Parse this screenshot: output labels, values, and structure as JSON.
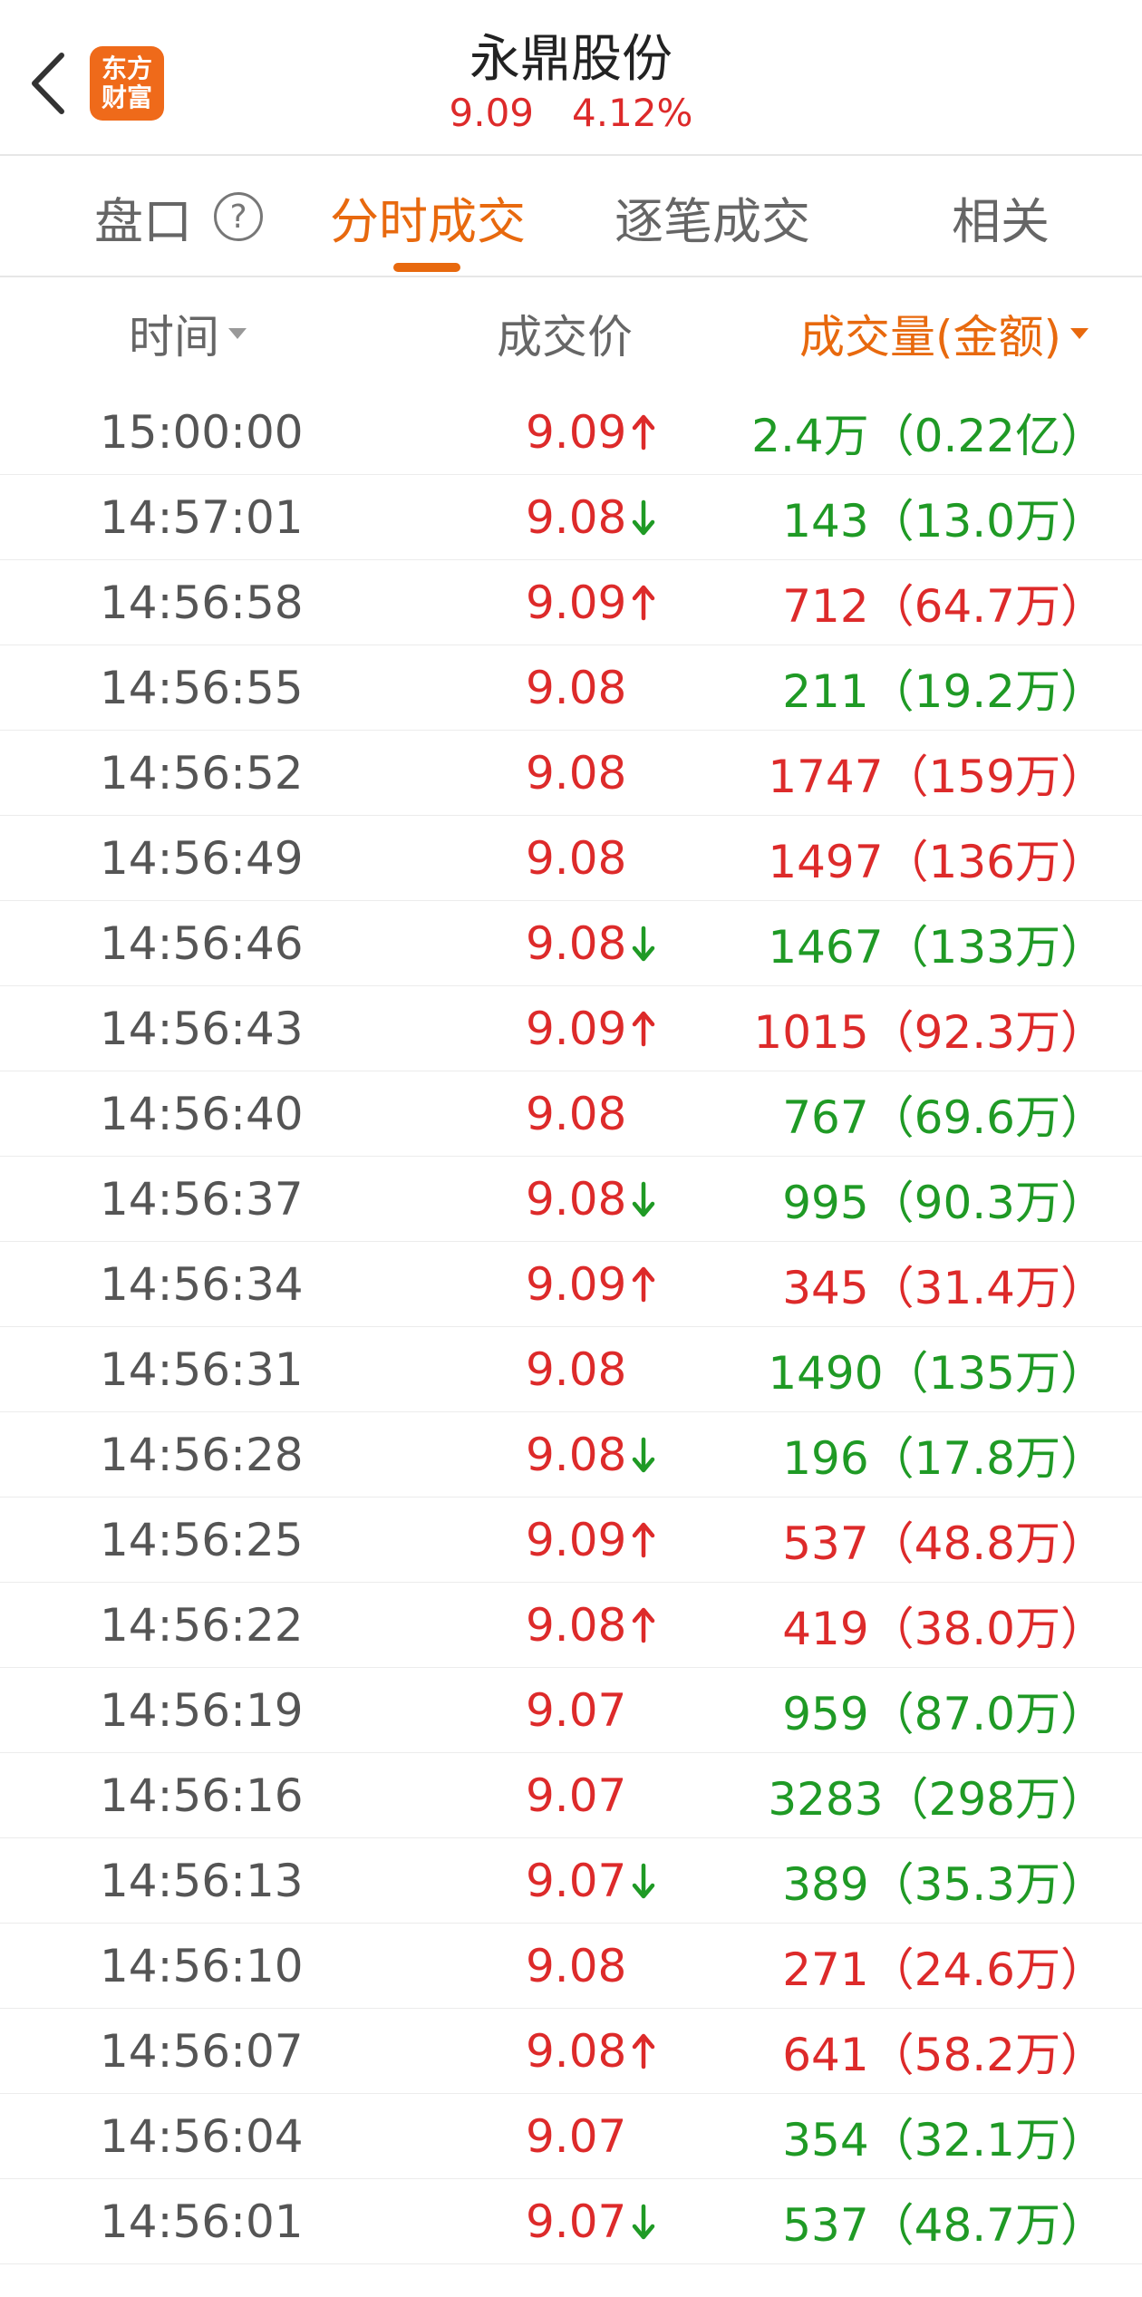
{
  "header": {
    "title": "永鼎股份",
    "price": "9.09",
    "change_pct": "4.12%",
    "logo_line1": "东方",
    "logo_line2": "财富",
    "back_icon": "chevron-left-icon"
  },
  "tabs": [
    {
      "label": "盘口",
      "active": false
    },
    {
      "label": "分时成交",
      "active": true
    },
    {
      "label": "逐笔成交",
      "active": false
    },
    {
      "label": "相关",
      "active": false
    }
  ],
  "help_icon_label": "?",
  "columns": {
    "time": "时间",
    "price": "成交价",
    "volume": "成交量(金额)"
  },
  "colors": {
    "up": "#dd2a2a",
    "down": "#1f9a25",
    "accent": "#e8690e"
  },
  "trades": [
    {
      "time": "15:00:00",
      "price": "9.09",
      "arrow": "up",
      "volume": "2.4万（0.22亿）",
      "vol_color": "green"
    },
    {
      "time": "14:57:01",
      "price": "9.08",
      "arrow": "down",
      "volume": "143（13.0万）",
      "vol_color": "green"
    },
    {
      "time": "14:56:58",
      "price": "9.09",
      "arrow": "up",
      "volume": "712（64.7万）",
      "vol_color": "red"
    },
    {
      "time": "14:56:55",
      "price": "9.08",
      "arrow": "",
      "volume": "211（19.2万）",
      "vol_color": "green"
    },
    {
      "time": "14:56:52",
      "price": "9.08",
      "arrow": "",
      "volume": "1747（159万）",
      "vol_color": "red"
    },
    {
      "time": "14:56:49",
      "price": "9.08",
      "arrow": "",
      "volume": "1497（136万）",
      "vol_color": "red"
    },
    {
      "time": "14:56:46",
      "price": "9.08",
      "arrow": "down",
      "volume": "1467（133万）",
      "vol_color": "green"
    },
    {
      "time": "14:56:43",
      "price": "9.09",
      "arrow": "up",
      "volume": "1015（92.3万）",
      "vol_color": "red"
    },
    {
      "time": "14:56:40",
      "price": "9.08",
      "arrow": "",
      "volume": "767（69.6万）",
      "vol_color": "green"
    },
    {
      "time": "14:56:37",
      "price": "9.08",
      "arrow": "down",
      "volume": "995（90.3万）",
      "vol_color": "green"
    },
    {
      "time": "14:56:34",
      "price": "9.09",
      "arrow": "up",
      "volume": "345（31.4万）",
      "vol_color": "red"
    },
    {
      "time": "14:56:31",
      "price": "9.08",
      "arrow": "",
      "volume": "1490（135万）",
      "vol_color": "green"
    },
    {
      "time": "14:56:28",
      "price": "9.08",
      "arrow": "down",
      "volume": "196（17.8万）",
      "vol_color": "green"
    },
    {
      "time": "14:56:25",
      "price": "9.09",
      "arrow": "up",
      "volume": "537（48.8万）",
      "vol_color": "red"
    },
    {
      "time": "14:56:22",
      "price": "9.08",
      "arrow": "up",
      "volume": "419（38.0万）",
      "vol_color": "red"
    },
    {
      "time": "14:56:19",
      "price": "9.07",
      "arrow": "",
      "volume": "959（87.0万）",
      "vol_color": "green"
    },
    {
      "time": "14:56:16",
      "price": "9.07",
      "arrow": "",
      "volume": "3283（298万）",
      "vol_color": "green"
    },
    {
      "time": "14:56:13",
      "price": "9.07",
      "arrow": "down",
      "volume": "389（35.3万）",
      "vol_color": "green"
    },
    {
      "time": "14:56:10",
      "price": "9.08",
      "arrow": "",
      "volume": "271（24.6万）",
      "vol_color": "red"
    },
    {
      "time": "14:56:07",
      "price": "9.08",
      "arrow": "up",
      "volume": "641（58.2万）",
      "vol_color": "red"
    },
    {
      "time": "14:56:04",
      "price": "9.07",
      "arrow": "",
      "volume": "354（32.1万）",
      "vol_color": "green"
    },
    {
      "time": "14:56:01",
      "price": "9.07",
      "arrow": "down",
      "volume": "537（48.7万）",
      "vol_color": "green"
    }
  ]
}
